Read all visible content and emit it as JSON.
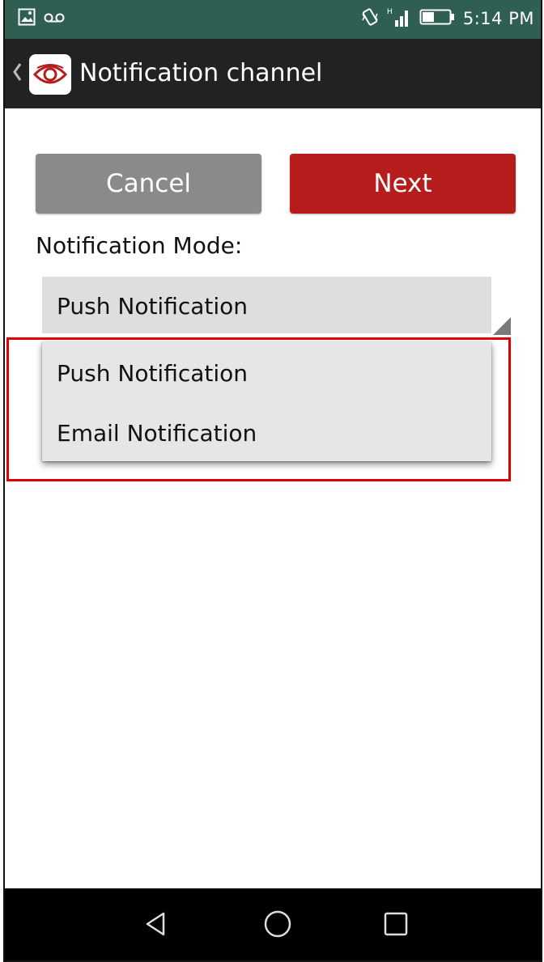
{
  "status_bar": {
    "time": "5:14 PM",
    "left_icons": [
      "gallery-icon",
      "voicemail-icon"
    ],
    "right_icons": [
      "vibrate-icon",
      "signal-icon",
      "battery-icon"
    ],
    "color": "#2f5e52"
  },
  "action_bar": {
    "title": "Notification channel",
    "back_icon": "chevron-left-icon",
    "app_icon": "eye-logo-icon"
  },
  "buttons": {
    "cancel_label": "Cancel",
    "next_label": "Next",
    "cancel_color": "#8a8a8a",
    "next_color": "#b71c1c"
  },
  "form": {
    "mode_label": "Notification Mode:",
    "selected_value": "Push Notification",
    "options": [
      "Push Notification",
      "Email Notification"
    ]
  },
  "nav_bar": {
    "icons": [
      "back-triangle-icon",
      "home-circle-icon",
      "recents-square-icon"
    ]
  },
  "annotation": {
    "highlight_color": "#e00000"
  }
}
